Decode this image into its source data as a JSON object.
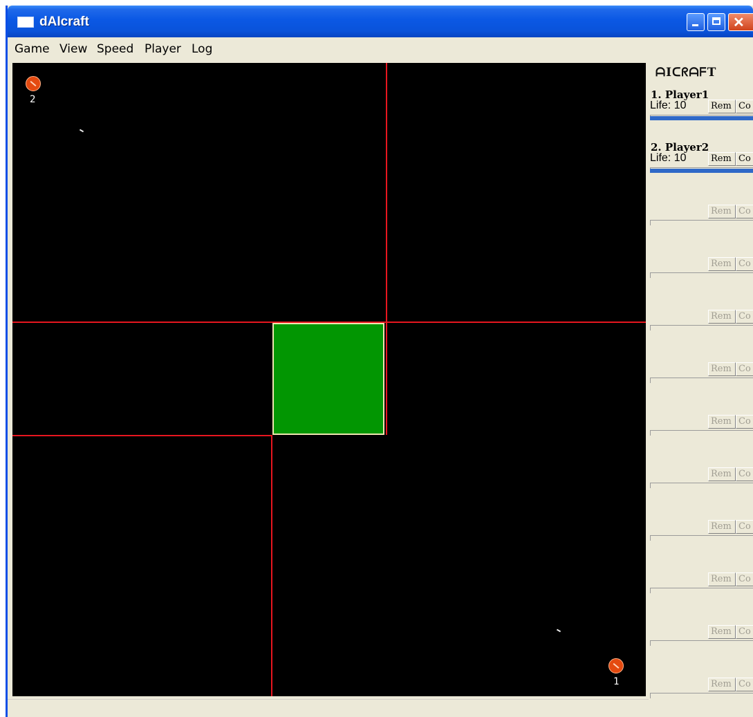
{
  "window": {
    "title": "dAIcraft"
  },
  "menu": {
    "items": [
      "Game",
      "View",
      "Speed",
      "Player",
      "Log"
    ]
  },
  "map": {
    "units": [
      {
        "id": "2",
        "label": "2"
      },
      {
        "id": "1",
        "label": "1"
      }
    ]
  },
  "panel": {
    "logo": "ᗩIᑕᖇᗩᖴT",
    "players": [
      {
        "name": "1. Player1",
        "life": "Life: 10",
        "rem": "Rem",
        "con": "Co",
        "health": 1.0,
        "enabled": true
      },
      {
        "name": "2. Player2",
        "life": "Life: 10",
        "rem": "Rem",
        "con": "Co",
        "health": 1.0,
        "enabled": true
      },
      {
        "name": "",
        "life": "",
        "rem": "Rem",
        "con": "Co",
        "health": 0,
        "enabled": false
      },
      {
        "name": "",
        "life": "",
        "rem": "Rem",
        "con": "Co",
        "health": 0,
        "enabled": false
      },
      {
        "name": "",
        "life": "",
        "rem": "Rem",
        "con": "Co",
        "health": 0,
        "enabled": false
      },
      {
        "name": "",
        "life": "",
        "rem": "Rem",
        "con": "Co",
        "health": 0,
        "enabled": false
      },
      {
        "name": "",
        "life": "",
        "rem": "Rem",
        "con": "Co",
        "health": 0,
        "enabled": false
      },
      {
        "name": "",
        "life": "",
        "rem": "Rem",
        "con": "Co",
        "health": 0,
        "enabled": false
      },
      {
        "name": "",
        "life": "",
        "rem": "Rem",
        "con": "Co",
        "health": 0,
        "enabled": false
      },
      {
        "name": "",
        "life": "",
        "rem": "Rem",
        "con": "Co",
        "health": 0,
        "enabled": false
      },
      {
        "name": "",
        "life": "",
        "rem": "Rem",
        "con": "Co",
        "health": 0,
        "enabled": false
      },
      {
        "name": "",
        "life": "",
        "rem": "Rem",
        "con": "Co",
        "health": 0,
        "enabled": false
      }
    ]
  },
  "colors": {
    "grid_line": "#e8161f",
    "center_zone": "#029602",
    "unit": "#e44a10",
    "health_bar": "#2f69c8"
  }
}
